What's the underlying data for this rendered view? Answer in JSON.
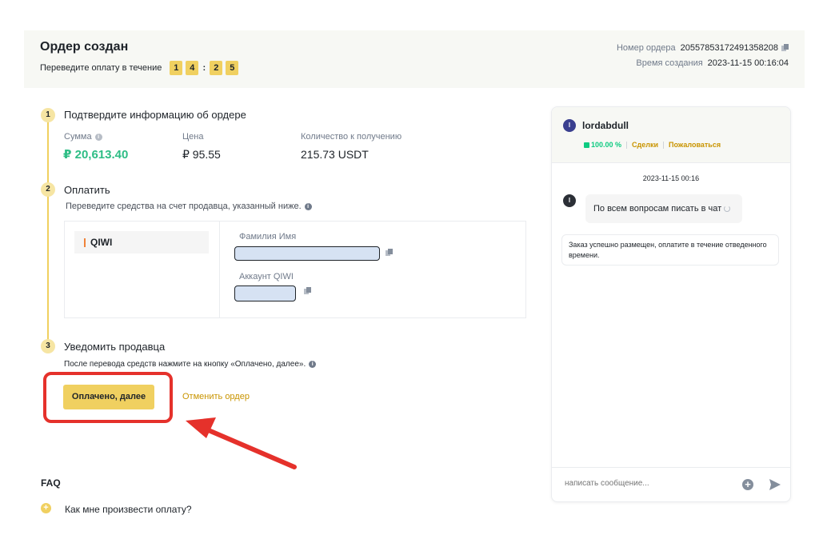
{
  "header": {
    "title": "Ордер создан",
    "timer_label": "Переведите оплату в течение",
    "timer_digits": [
      "1",
      "4",
      "2",
      "5"
    ],
    "timer_sep": ":",
    "order_number_label": "Номер ордера",
    "order_number": "20557853172491358208",
    "created_label": "Время создания",
    "created_time": "2023-11-15 00:16:04"
  },
  "steps": [
    {
      "num": "1",
      "title": "Подтвердите информацию об ордере"
    },
    {
      "num": "2",
      "title": "Оплатить"
    },
    {
      "num": "3",
      "title": "Уведомить продавца"
    }
  ],
  "order_info": {
    "amount_label": "Сумма",
    "amount": "₽ 20,613.40",
    "price_label": "Цена",
    "price": "₽ 95.55",
    "qty_label": "Количество к получению",
    "qty": "215.73 USDT"
  },
  "payment": {
    "instruction": "Переведите средства на счет продавца, указанный ниже.",
    "method": "QIWI",
    "name_label": "Фамилия Имя",
    "account_label": "Аккаунт QIWI"
  },
  "notify": {
    "instruction": "После перевода средств нажмите на кнопку «Оплачено, далее».",
    "paid_button": "Оплачено, далее",
    "cancel_button": "Отменить ордер"
  },
  "faq": {
    "title": "FAQ",
    "question": "Как мне произвести оплату?",
    "expand_glyph": "+"
  },
  "chat": {
    "seller_initial": "l",
    "seller_name": "lordabdull",
    "completion_rate": "100.00 %",
    "trades_link": "Сделки",
    "complain_link": "Пожаловаться",
    "date": "2023-11-15 00:16",
    "sender_initial": "l",
    "message": "По всем вопросам писать в чат",
    "system_message": "Заказ успешно размещен, оплатите в течение отведенного времени.",
    "input_placeholder": "написать сообщение...",
    "plus_glyph": "+"
  },
  "colors": {
    "accent": "#f0d060",
    "annotation_red": "#e5312b",
    "positive_green": "#0ecb81",
    "link_gold": "#c99400"
  }
}
